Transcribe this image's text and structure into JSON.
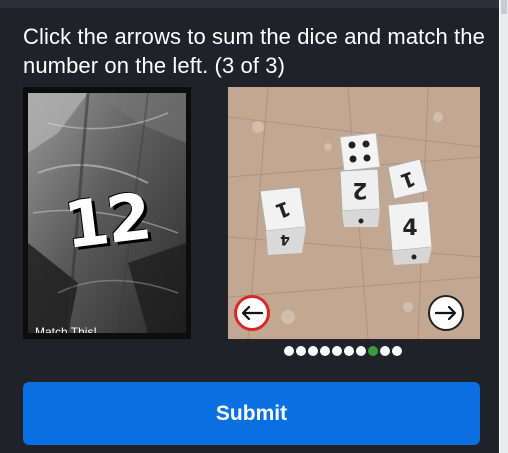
{
  "instruction": "Click the arrows to sum the dice and match the number on the left. (3 of 3)",
  "target": {
    "number": "12",
    "label": "Match This!"
  },
  "dice_image": {
    "visible_faces": [
      "1",
      "2",
      "4",
      "4",
      "1"
    ],
    "pip_face": 4
  },
  "carousel": {
    "total_dots": 10,
    "active_index": 7
  },
  "buttons": {
    "submit_label": "Submit"
  },
  "colors": {
    "panel_bg": "#1f2329",
    "submit_bg": "#0a6fe0",
    "active_dot": "#3d9a3d",
    "left_arrow_ring": "#d62828"
  }
}
